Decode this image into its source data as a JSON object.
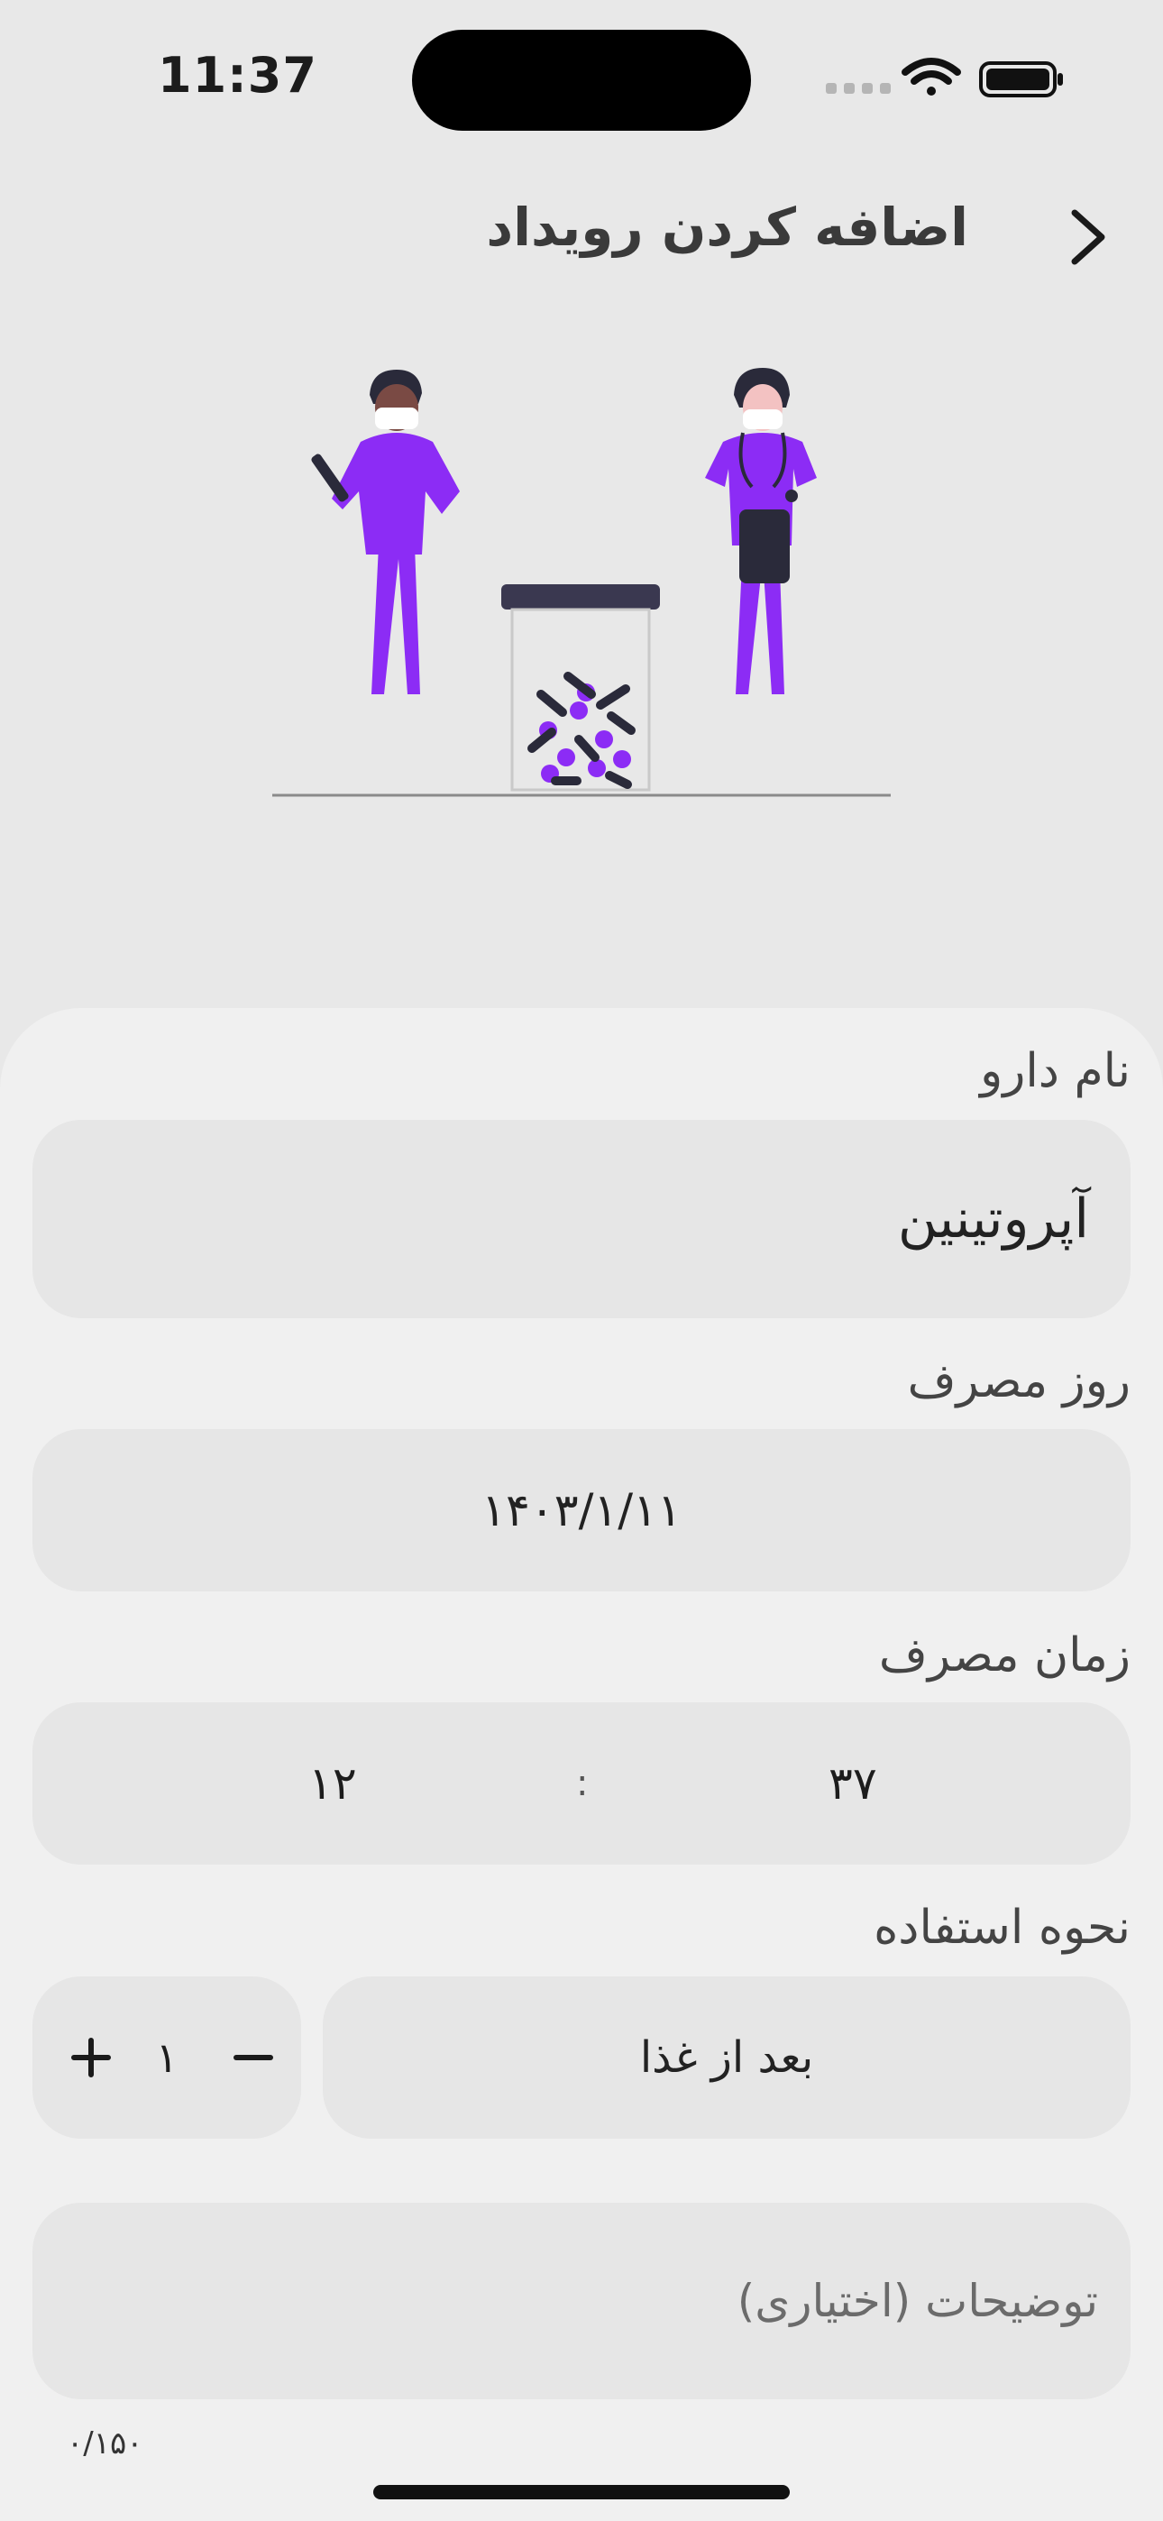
{
  "status_bar": {
    "time": "11:37"
  },
  "header": {
    "title": "اضافه کردن رویداد",
    "back_icon": "chevron-right-icon"
  },
  "form": {
    "drug_name": {
      "label": "نام دارو",
      "value": "آپروتینین"
    },
    "date": {
      "label": "روز مصرف",
      "value": "۱۴۰۳/۱/۱۱"
    },
    "time": {
      "label": "زمان مصرف",
      "hour": "۱۲",
      "separator": ":",
      "minute": "۳۷"
    },
    "usage": {
      "label": "نحوه استفاده",
      "when": "بعد از غذا",
      "quantity": "۱"
    },
    "notes": {
      "placeholder": "توضیحات (اختیاری)",
      "counter": "۰/۱۵۰"
    }
  },
  "colors": {
    "accent": "#8c2cf5",
    "background": "#e8e8e8",
    "card": "#f0f0f0",
    "field": "#e6e6e6"
  }
}
